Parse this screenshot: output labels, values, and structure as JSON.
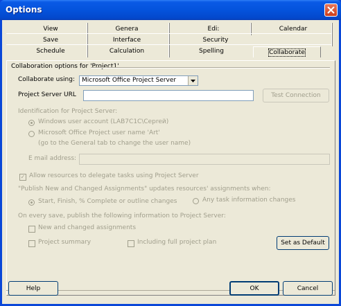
{
  "window": {
    "title": "Options"
  },
  "tabs": {
    "row1": [
      "View",
      "Genera",
      "Edi:",
      "Calendar"
    ],
    "row2": [
      "Save",
      "Interface",
      "Security"
    ],
    "row3": [
      "Schedule",
      "Calculation",
      "Spelling",
      "Collaborate"
    ]
  },
  "collab": {
    "section_title": "Collaboration options for 'Project1'",
    "using_label": "Collaborate using:",
    "using_value": "Microsoft Office Project Server",
    "server_url_label": "Project Server URL",
    "server_url_value": "",
    "test_connection": "Test Connection",
    "identification_label": "Identification for Project Server:",
    "windows_account": "Windows user account (LAB7C1C\\Cepreй)",
    "ms_username": "Microsoft Office Project user name 'Art'",
    "ms_username_note": "(go to the General tab to change the user name)",
    "email_label": "E mail address:",
    "email_value": "",
    "allow_delegate": "Allow resources to delegate tasks using Project Server",
    "publish_note": "\"Publish New and Changed Assignments\" updates resources' assignments when:",
    "opt_start_finish": "Start, Finish, % Complete or outline changes",
    "opt_any_change": "Any task information changes",
    "on_save_label": "On every save, publish the following information to Project Server:",
    "new_changed": "New and changed assignments",
    "project_summary": "Project summary",
    "including_full": "Including full project plan",
    "set_default": "Set as Default"
  },
  "footer": {
    "help": "Help",
    "ok": "OK",
    "cancel": "Cancel"
  }
}
